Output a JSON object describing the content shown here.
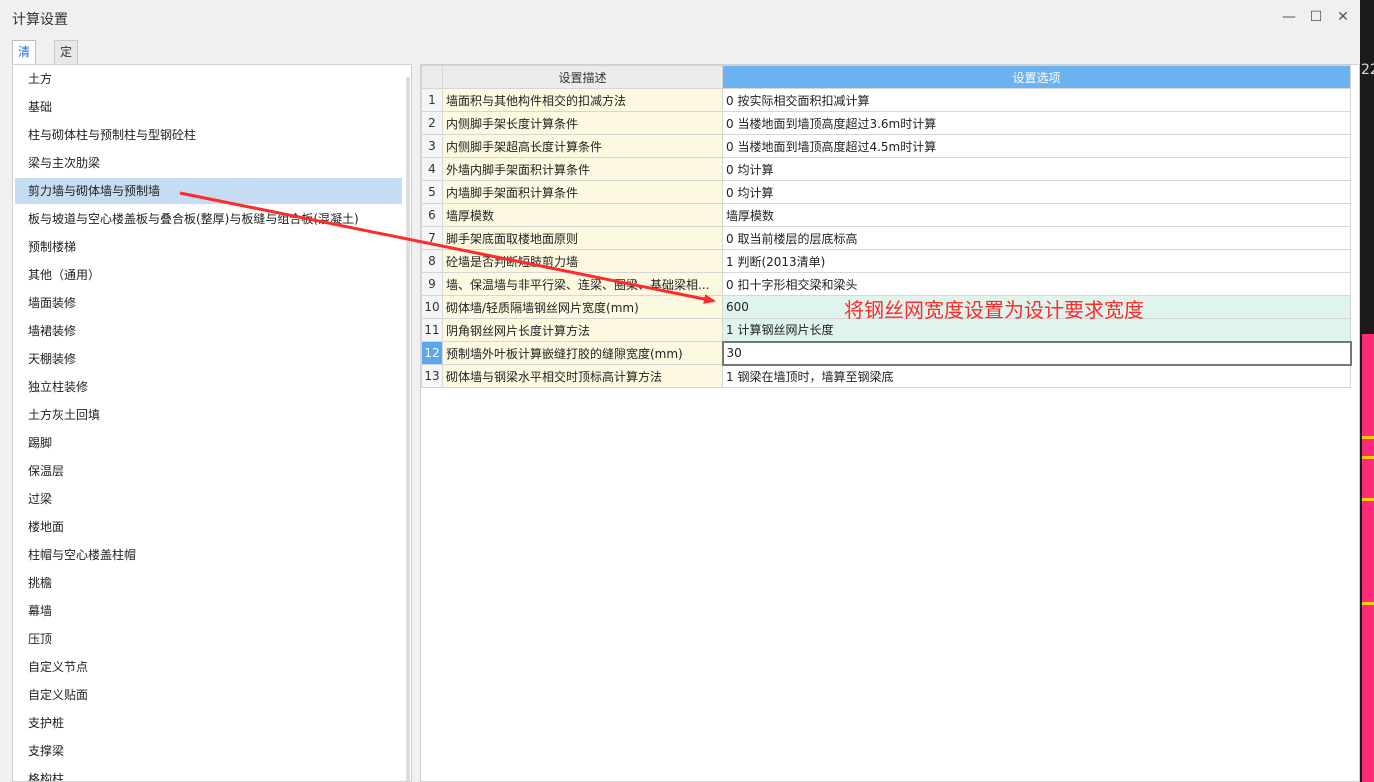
{
  "window": {
    "title": "计算设置",
    "minimize_glyph": "—",
    "maximize_glyph": "☐",
    "close_glyph": "✕"
  },
  "tabs": [
    "清单",
    "定额"
  ],
  "active_tab": 0,
  "categories": [
    "土方",
    "基础",
    "柱与砌体柱与预制柱与型钢砼柱",
    "梁与主次肋梁",
    "剪力墙与砌体墙与预制墙",
    "板与坡道与空心楼盖板与叠合板(整厚)与板缝与组合板(混凝土)",
    "预制楼梯",
    "其他（通用）",
    "墙面装修",
    "墙裙装修",
    "天棚装修",
    "独立柱装修",
    "土方灰土回填",
    "踢脚",
    "保温层",
    "过梁",
    "楼地面",
    "柱帽与空心楼盖柱帽",
    "挑檐",
    "幕墙",
    "压顶",
    "自定义节点",
    "自定义贴面",
    "支护桩",
    "支撑梁",
    "格构柱"
  ],
  "selected_category": 4,
  "table": {
    "headers": {
      "num": "",
      "desc": "设置描述",
      "option": "设置选项"
    },
    "rows": [
      {
        "num": "1",
        "desc": "墙面积与其他构件相交的扣减方法",
        "option": "0 按实际相交面积扣减计算"
      },
      {
        "num": "2",
        "desc": "内侧脚手架长度计算条件",
        "option": "0 当楼地面到墙顶高度超过3.6m时计算"
      },
      {
        "num": "3",
        "desc": "内侧脚手架超高长度计算条件",
        "option": "0 当楼地面到墙顶高度超过4.5m时计算"
      },
      {
        "num": "4",
        "desc": "外墙内脚手架面积计算条件",
        "option": "0 均计算"
      },
      {
        "num": "5",
        "desc": "内墙脚手架面积计算条件",
        "option": "0 均计算"
      },
      {
        "num": "6",
        "desc": "墙厚模数",
        "option": "墙厚模数"
      },
      {
        "num": "7",
        "desc": "脚手架底面取楼地面原则",
        "option": "0 取当前楼层的层底标高"
      },
      {
        "num": "8",
        "desc": "砼墙是否判断短肢剪力墙",
        "option": "1 判断(2013清单)"
      },
      {
        "num": "9",
        "desc": "墙、保温墙与非平行梁、连梁、圈梁、基础梁相...",
        "option": "0 扣十字形相交梁和梁头"
      },
      {
        "num": "10",
        "desc": "砌体墙/轻质隔墙钢丝网片宽度(mm)",
        "option": "600"
      },
      {
        "num": "11",
        "desc": "阴角钢丝网片长度计算方法",
        "option": "1 计算钢丝网片长度"
      },
      {
        "num": "12",
        "desc": "预制墙外叶板计算嵌缝打胶的缝隙宽度(mm)",
        "option": "30"
      },
      {
        "num": "13",
        "desc": "砌体墙与钢梁水平相交时顶标高计算方法",
        "option": "1 钢梁在墙顶时，墙算至钢梁底"
      }
    ],
    "highlight_rows": [
      10,
      11
    ],
    "current_row": 12
  },
  "annotation": {
    "text": "将钢丝网宽度设置为设计要求宽度",
    "color": "#ff2a2a"
  },
  "edge_text": "22"
}
